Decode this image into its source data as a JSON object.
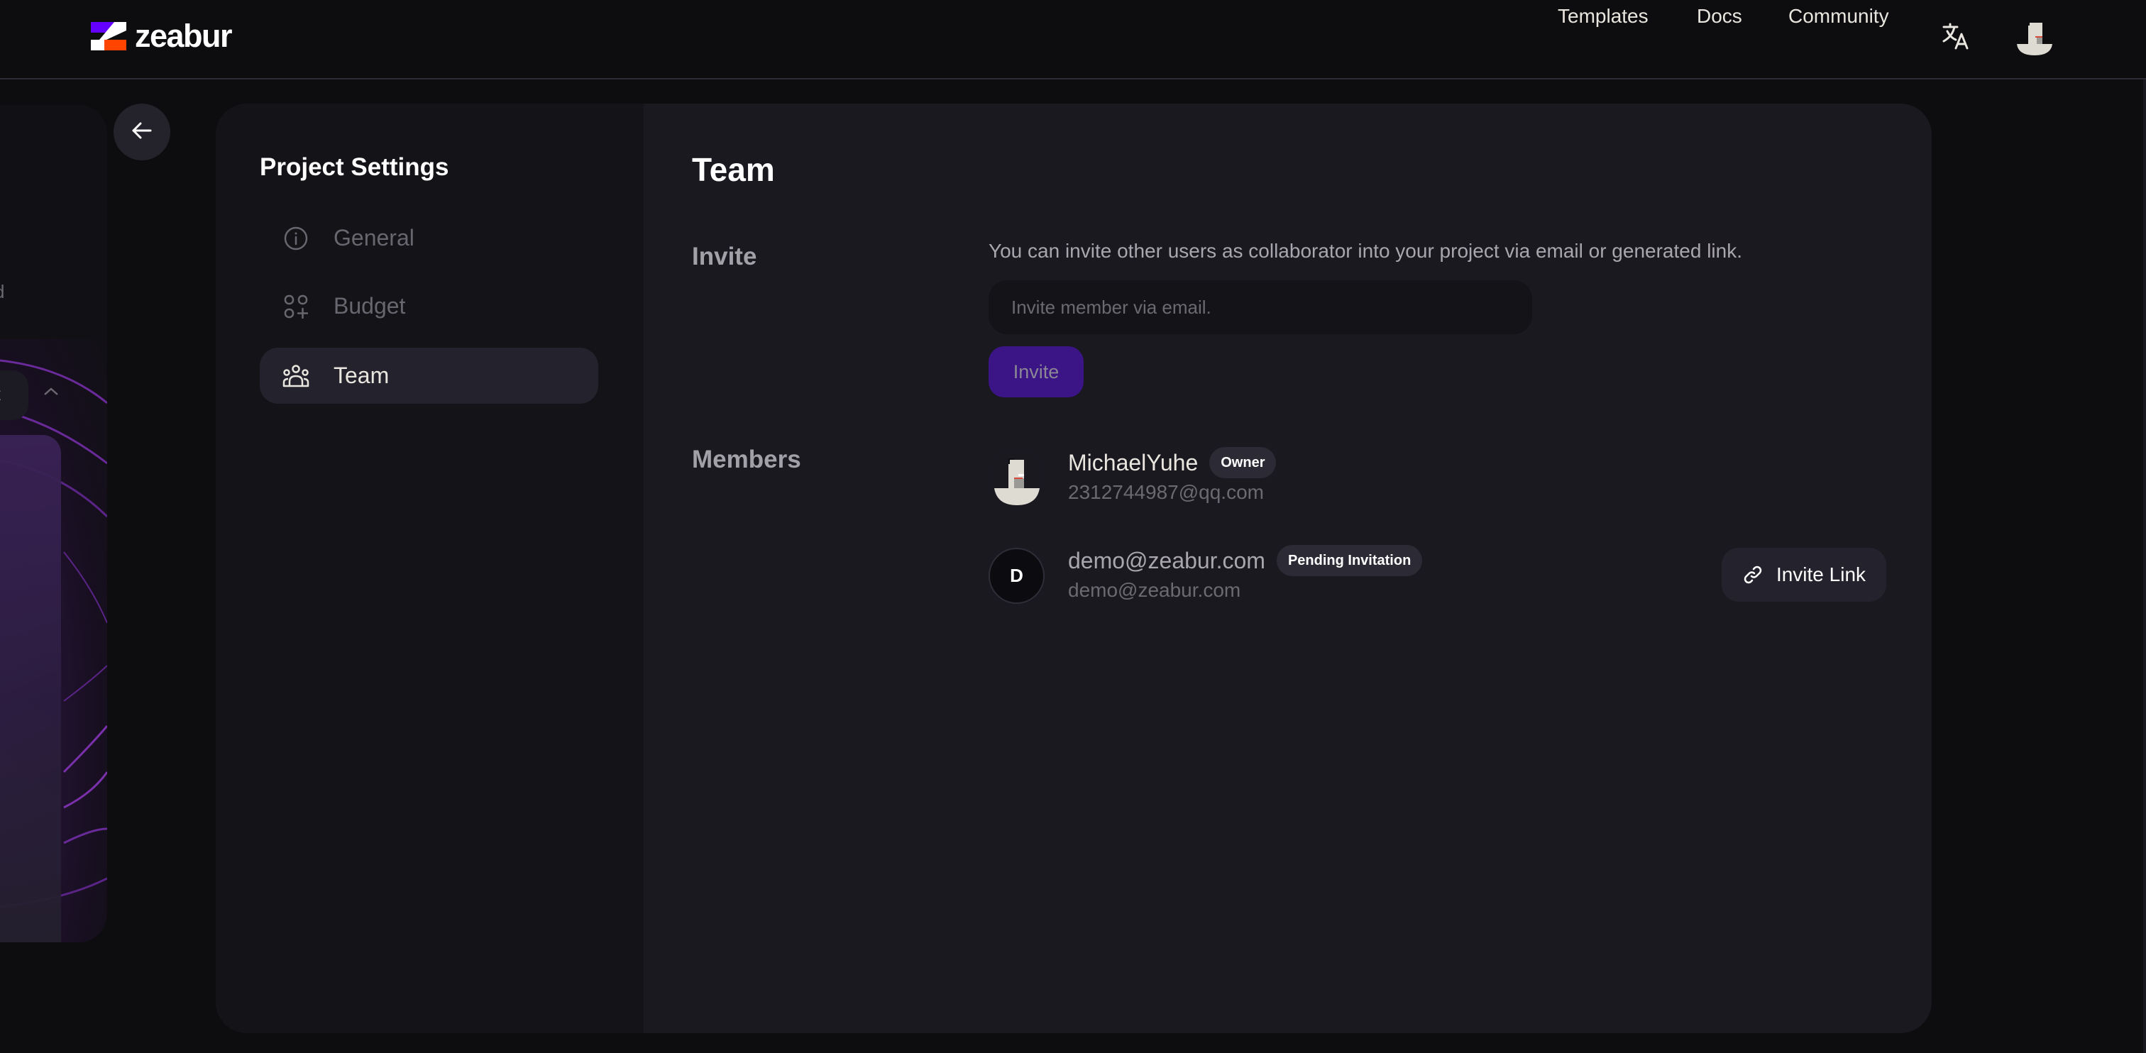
{
  "header": {
    "brand": "zeabur",
    "nav": [
      {
        "label": "Templates"
      },
      {
        "label": "Docs"
      },
      {
        "label": "Community"
      }
    ],
    "translate_icon": "translate-icon",
    "avatar_icon": "user-avatar"
  },
  "background": {
    "fragment_1": "d",
    "fragment_2": "t"
  },
  "back_button_icon": "arrow-left-icon",
  "sidebar": {
    "title": "Project Settings",
    "items": [
      {
        "label": "General",
        "icon": "info-icon",
        "active": false
      },
      {
        "label": "Budget",
        "icon": "apps-add-icon",
        "active": false
      },
      {
        "label": "Team",
        "icon": "users-icon",
        "active": true
      }
    ]
  },
  "main": {
    "title": "Team",
    "invite": {
      "section_label": "Invite",
      "description": "You can invite other users as collaborator into your project via email or generated link.",
      "input_placeholder": "Invite member via email.",
      "input_value": "",
      "button_label": "Invite"
    },
    "members": {
      "section_label": "Members",
      "list": [
        {
          "name": "MichaelYuhe",
          "badge": "Owner",
          "email": "2312744987@qq.com",
          "avatar": "image"
        },
        {
          "name": "demo@zeabur.com",
          "badge": "Pending Invitation",
          "email": "demo@zeabur.com",
          "avatar_letter": "D"
        }
      ],
      "invite_link_label": "Invite Link"
    }
  },
  "colors": {
    "accent_purple": "#3b1486",
    "brand_purple": "#6300ff",
    "brand_orange": "#ff4400",
    "background": "#0d0d10",
    "card": "#1a1920",
    "sidebar": "#141318"
  }
}
